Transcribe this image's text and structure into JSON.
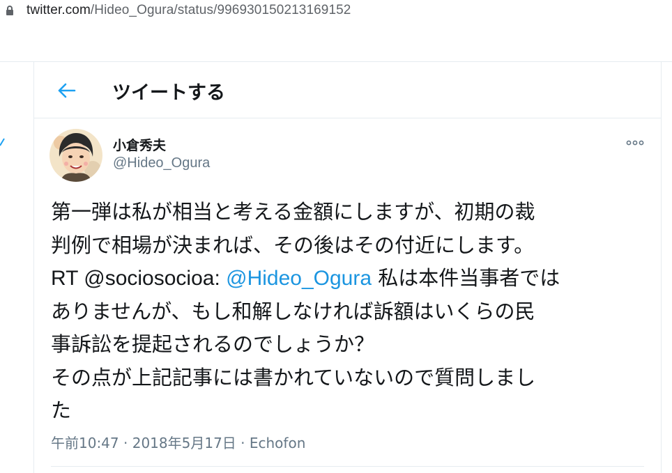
{
  "browser": {
    "url_host": "twitter.com",
    "url_path": "/Hideo_Ogura/status/996930150213169152",
    "lock_icon": "lock-icon"
  },
  "header": {
    "title": "ツイートする",
    "back_icon": "arrow-left-icon",
    "accent": "#1da1f2"
  },
  "tweet": {
    "author_name": "小倉秀夫",
    "author_handle": "@Hideo_Ogura",
    "lines": [
      {
        "a": "第一弾は私が相当と考える金額にしますが、初期の裁",
        "m": "",
        "b": ""
      },
      {
        "a": "判例で相場が決まれば、その後はその付近にします。",
        "m": "",
        "b": ""
      },
      {
        "a": "RT @sociosocioa: ",
        "m": "@Hideo_Ogura",
        "b": " 私は本件当事者では"
      },
      {
        "a": "ありませんが、もし和解しなければ訴額はいくらの民",
        "m": "",
        "b": ""
      },
      {
        "a": "事訴訟を提起されるのでしょうか？",
        "m": "",
        "b": ""
      },
      {
        "a": "その点が上記記事には書かれていないので質問しまし",
        "m": "",
        "b": ""
      },
      {
        "a": "た",
        "m": "",
        "b": ""
      }
    ],
    "time": "午前10:47",
    "date": "2018年5月17日",
    "source": "Echofon",
    "separator": " · ",
    "mention_color": "#1b95e0"
  }
}
